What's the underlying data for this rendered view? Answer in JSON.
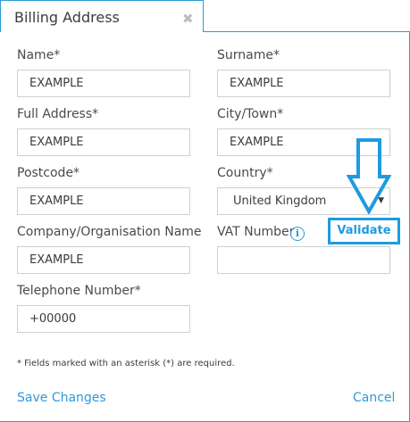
{
  "dialog": {
    "title": "Billing Address"
  },
  "form": {
    "name": {
      "label": "Name*",
      "value": "EXAMPLE"
    },
    "surname": {
      "label": "Surname*",
      "value": "EXAMPLE"
    },
    "full_address": {
      "label": "Full Address*",
      "value": "EXAMPLE"
    },
    "city": {
      "label": "City/Town*",
      "value": "EXAMPLE"
    },
    "postcode": {
      "label": "Postcode*",
      "value": "EXAMPLE"
    },
    "country": {
      "label": "Country*",
      "value": "United Kingdom"
    },
    "company": {
      "label": "Company/Organisation Name",
      "value": "EXAMPLE"
    },
    "vat": {
      "label": "VAT Number",
      "value": "",
      "validate_label": "Validate",
      "info_glyph": "i"
    },
    "telephone": {
      "label": "Telephone Number*",
      "value": "+00000"
    }
  },
  "footnote": "* Fields marked with an asterisk (*) are required.",
  "actions": {
    "save_label": "Save Changes",
    "cancel_label": "Cancel"
  },
  "icons": {
    "close": "close-icon",
    "info": "info-icon",
    "caret": "chevron-down-icon",
    "arrow": "arrow-down-icon"
  },
  "colors": {
    "accent": "#2e9bd6",
    "validate": "#1e9be0",
    "close": "#bdbdbd"
  }
}
